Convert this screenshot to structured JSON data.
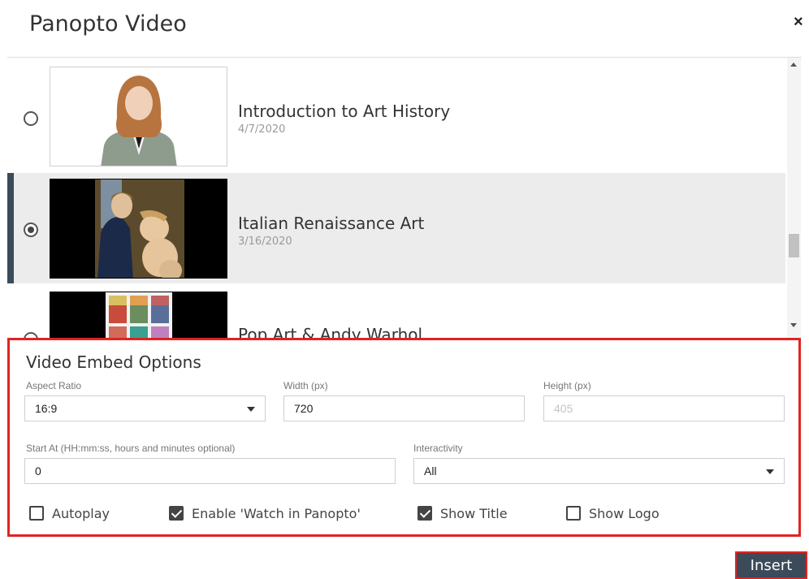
{
  "dialog": {
    "title": "Panopto Video",
    "close_label": "×"
  },
  "videos": [
    {
      "title": "Introduction to Art History",
      "date": "4/7/2020",
      "selected": false
    },
    {
      "title": "Italian Renaissance Art",
      "date": "3/16/2020",
      "selected": true
    },
    {
      "title": "Pop Art & Andy Warhol",
      "date": "",
      "selected": false
    }
  ],
  "embed": {
    "heading": "Video Embed Options",
    "aspect_ratio": {
      "label": "Aspect Ratio",
      "value": "16:9"
    },
    "width": {
      "label": "Width (px)",
      "value": "720"
    },
    "height": {
      "label": "Height (px)",
      "placeholder": "405"
    },
    "start_at": {
      "label": "Start At (HH:mm:ss, hours and minutes optional)",
      "value": "0"
    },
    "interactivity": {
      "label": "Interactivity",
      "value": "All"
    },
    "checkboxes": [
      {
        "label": "Autoplay",
        "checked": false
      },
      {
        "label": "Enable 'Watch in Panopto'",
        "checked": true
      },
      {
        "label": "Show Title",
        "checked": true
      },
      {
        "label": "Show Logo",
        "checked": false
      }
    ]
  },
  "footer": {
    "insert_label": "Insert"
  },
  "colors": {
    "accent": "#3b4b5a",
    "highlight_border": "#e1231f",
    "selected_row": "#ececec"
  }
}
